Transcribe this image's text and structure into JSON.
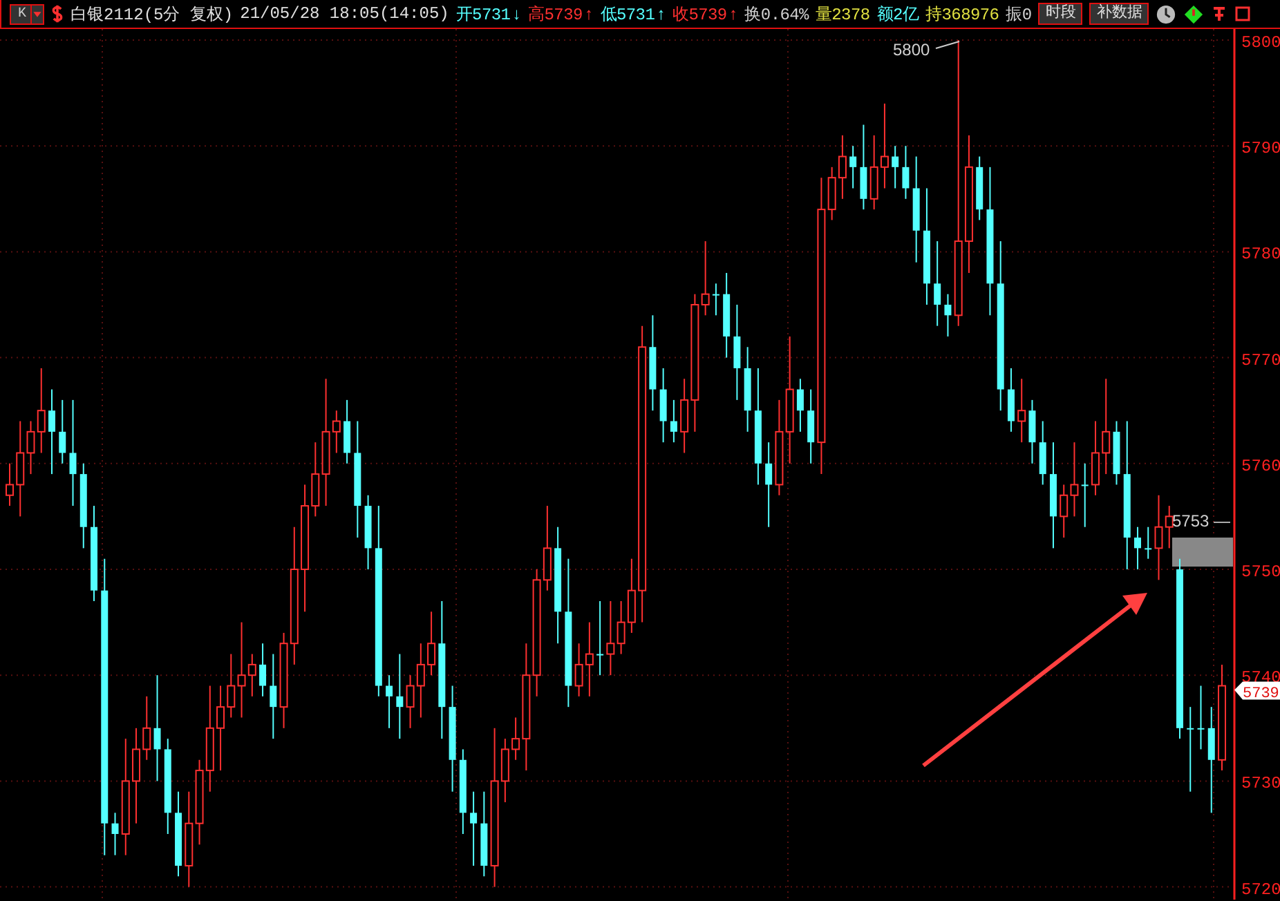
{
  "toolbar": {
    "period_selector": "K",
    "title": "白银2112(5分 复权)",
    "datetime": "21/05/28 18:05(14:05)",
    "quotes": [
      {
        "label": "开",
        "value": "5731",
        "arrow": "↓",
        "color": "#55ffff"
      },
      {
        "label": "高",
        "value": "5739",
        "arrow": "↑",
        "color": "#ff3030"
      },
      {
        "label": "低",
        "value": "5731",
        "arrow": "↑",
        "color": "#55ffff"
      },
      {
        "label": "收",
        "value": "5739",
        "arrow": "↑",
        "color": "#ff3030"
      },
      {
        "label": "换",
        "value": "0.64%",
        "color": "#d0d0d0"
      },
      {
        "label": "量",
        "value": "2378",
        "color": "#e0e040"
      },
      {
        "label": "额",
        "value": "2亿",
        "color": "#55ffff"
      },
      {
        "label": "持",
        "value": "368976",
        "color": "#e0e040"
      },
      {
        "label": "振",
        "value": "0",
        "color": "#d0d0d0"
      }
    ],
    "buttons": [
      {
        "label": "时段"
      },
      {
        "label": "补数据"
      }
    ]
  },
  "chart": {
    "high_label": "5800",
    "cursor_label": "5753 —",
    "last_price": "5739",
    "chart_data": {
      "type": "candlestick",
      "grid": true,
      "yticks": [
        5800,
        5790,
        5780,
        5770,
        5760,
        5750,
        5740,
        5730,
        5720
      ],
      "ylim": [
        5720,
        5800
      ],
      "ohlc": [
        [
          5757,
          5760,
          5756,
          5758
        ],
        [
          5758,
          5764,
          5755,
          5761
        ],
        [
          5761,
          5764,
          5759,
          5763
        ],
        [
          5763,
          5769,
          5761,
          5765
        ],
        [
          5765,
          5767,
          5759,
          5763
        ],
        [
          5763,
          5766,
          5760,
          5761
        ],
        [
          5761,
          5766,
          5756,
          5759
        ],
        [
          5759,
          5760,
          5752,
          5754
        ],
        [
          5754,
          5756,
          5747,
          5748
        ],
        [
          5748,
          5751,
          5723,
          5726
        ],
        [
          5726,
          5727,
          5723,
          5725
        ],
        [
          5725,
          5734,
          5723,
          5730
        ],
        [
          5730,
          5735,
          5726,
          5733
        ],
        [
          5733,
          5738,
          5732,
          5735
        ],
        [
          5735,
          5740,
          5730,
          5733
        ],
        [
          5733,
          5734,
          5725,
          5727
        ],
        [
          5727,
          5729,
          5721,
          5722
        ],
        [
          5722,
          5729,
          5720,
          5726
        ],
        [
          5726,
          5732,
          5724,
          5731
        ],
        [
          5731,
          5739,
          5729,
          5735
        ],
        [
          5735,
          5739,
          5731,
          5737
        ],
        [
          5737,
          5742,
          5736,
          5739
        ],
        [
          5739,
          5745,
          5736,
          5740
        ],
        [
          5740,
          5742,
          5738,
          5741
        ],
        [
          5741,
          5743,
          5738,
          5739
        ],
        [
          5739,
          5742,
          5734,
          5737
        ],
        [
          5737,
          5744,
          5735,
          5743
        ],
        [
          5743,
          5754,
          5741,
          5750
        ],
        [
          5750,
          5758,
          5746,
          5756
        ],
        [
          5756,
          5762,
          5755,
          5759
        ],
        [
          5759,
          5768,
          5756,
          5763
        ],
        [
          5763,
          5765,
          5761,
          5764
        ],
        [
          5764,
          5766,
          5760,
          5761
        ],
        [
          5761,
          5764,
          5753,
          5756
        ],
        [
          5756,
          5757,
          5750,
          5752
        ],
        [
          5752,
          5756,
          5738,
          5739
        ],
        [
          5739,
          5740,
          5735,
          5738
        ],
        [
          5738,
          5742,
          5734,
          5737
        ],
        [
          5737,
          5740,
          5735,
          5739
        ],
        [
          5739,
          5743,
          5736,
          5741
        ],
        [
          5741,
          5746,
          5740,
          5743
        ],
        [
          5743,
          5747,
          5734,
          5737
        ],
        [
          5737,
          5739,
          5729,
          5732
        ],
        [
          5732,
          5733,
          5725,
          5727
        ],
        [
          5727,
          5729,
          5722,
          5726
        ],
        [
          5726,
          5729,
          5721,
          5722
        ],
        [
          5722,
          5735,
          5720,
          5730
        ],
        [
          5730,
          5734,
          5728,
          5733
        ],
        [
          5733,
          5736,
          5732,
          5734
        ],
        [
          5734,
          5743,
          5731,
          5740
        ],
        [
          5740,
          5750,
          5738,
          5749
        ],
        [
          5749,
          5756,
          5748,
          5752
        ],
        [
          5752,
          5754,
          5743,
          5746
        ],
        [
          5746,
          5751,
          5737,
          5739
        ],
        [
          5739,
          5743,
          5738,
          5741
        ],
        [
          5741,
          5745,
          5738,
          5742
        ],
        [
          5742,
          5747,
          5740,
          5742
        ],
        [
          5742,
          5747,
          5740,
          5743
        ],
        [
          5743,
          5747,
          5742,
          5745
        ],
        [
          5745,
          5751,
          5744,
          5748
        ],
        [
          5748,
          5773,
          5745,
          5771
        ],
        [
          5771,
          5774,
          5765,
          5767
        ],
        [
          5767,
          5769,
          5762,
          5764
        ],
        [
          5764,
          5766,
          5762,
          5763
        ],
        [
          5763,
          5768,
          5761,
          5766
        ],
        [
          5766,
          5776,
          5763,
          5775
        ],
        [
          5775,
          5781,
          5774,
          5776
        ],
        [
          5776,
          5777,
          5774,
          5776
        ],
        [
          5776,
          5778,
          5770,
          5772
        ],
        [
          5772,
          5775,
          5766,
          5769
        ],
        [
          5769,
          5771,
          5763,
          5765
        ],
        [
          5765,
          5769,
          5758,
          5760
        ],
        [
          5760,
          5762,
          5754,
          5758
        ],
        [
          5758,
          5766,
          5757,
          5763
        ],
        [
          5763,
          5772,
          5760,
          5767
        ],
        [
          5767,
          5768,
          5763,
          5765
        ],
        [
          5765,
          5767,
          5760,
          5762
        ],
        [
          5762,
          5787,
          5759,
          5784
        ],
        [
          5784,
          5788,
          5783,
          5787
        ],
        [
          5787,
          5791,
          5785,
          5789
        ],
        [
          5789,
          5790,
          5786,
          5788
        ],
        [
          5788,
          5792,
          5784,
          5785
        ],
        [
          5785,
          5791,
          5784,
          5788
        ],
        [
          5788,
          5794,
          5786,
          5789
        ],
        [
          5789,
          5790,
          5786,
          5788
        ],
        [
          5788,
          5790,
          5785,
          5786
        ],
        [
          5786,
          5789,
          5779,
          5782
        ],
        [
          5782,
          5786,
          5775,
          5777
        ],
        [
          5777,
          5781,
          5773,
          5775
        ],
        [
          5775,
          5776,
          5772,
          5774
        ],
        [
          5774,
          5800,
          5773,
          5781
        ],
        [
          5781,
          5791,
          5778,
          5788
        ],
        [
          5788,
          5789,
          5783,
          5784
        ],
        [
          5784,
          5788,
          5774,
          5777
        ],
        [
          5777,
          5781,
          5765,
          5767
        ],
        [
          5767,
          5769,
          5763,
          5764
        ],
        [
          5764,
          5768,
          5762,
          5765
        ],
        [
          5765,
          5766,
          5760,
          5762
        ],
        [
          5762,
          5764,
          5758,
          5759
        ],
        [
          5759,
          5762,
          5752,
          5755
        ],
        [
          5755,
          5758,
          5753,
          5757
        ],
        [
          5757,
          5762,
          5755,
          5758
        ],
        [
          5758,
          5760,
          5754,
          5758
        ],
        [
          5758,
          5764,
          5757,
          5761
        ],
        [
          5761,
          5768,
          5759,
          5763
        ],
        [
          5763,
          5764,
          5758,
          5759
        ],
        [
          5759,
          5764,
          5750,
          5753
        ],
        [
          5753,
          5754,
          5750,
          5752
        ],
        [
          5752,
          5754,
          5751,
          5752
        ],
        [
          5752,
          5757,
          5749,
          5754
        ],
        [
          5754,
          5756,
          5752,
          5755
        ],
        [
          5750,
          5751,
          5734,
          5735
        ],
        [
          5735,
          5737,
          5729,
          5735
        ],
        [
          5735,
          5739,
          5733,
          5735
        ],
        [
          5735,
          5737,
          5727,
          5732
        ],
        [
          5732,
          5741,
          5731,
          5739
        ]
      ]
    }
  }
}
